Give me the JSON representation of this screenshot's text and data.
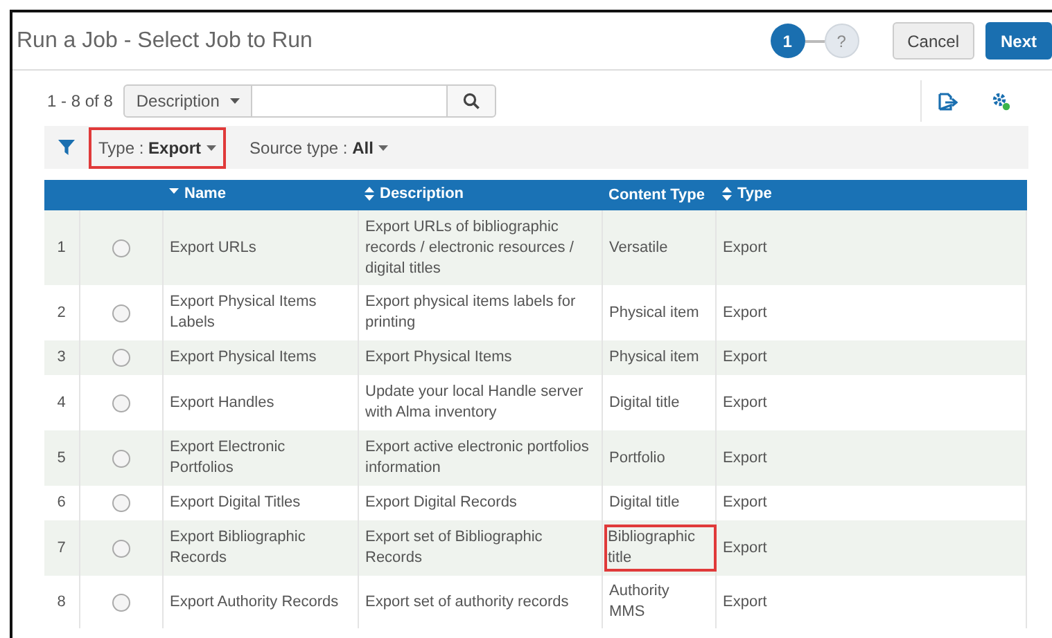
{
  "title": "Run a Job - Select Job to Run",
  "steps": [
    {
      "label": "1",
      "selected": true
    },
    {
      "label": "?",
      "selected": false
    }
  ],
  "buttons": [
    {
      "label": "Cancel",
      "kind": "secondary"
    },
    {
      "label": "Next",
      "kind": "primary"
    }
  ],
  "count": "1 - 8 of 8",
  "search": {
    "scope": "Description"
  },
  "filters": [
    {
      "label": "Type :",
      "value": "Export",
      "highlighted": true
    },
    {
      "label": "Source type :",
      "value": "All",
      "highlighted": false
    }
  ],
  "columns": [
    {
      "label": "Name",
      "sortable": true,
      "sorted": true
    },
    {
      "label": "Description",
      "sortable": true,
      "sorted": false
    },
    {
      "label": "Content Type",
      "sortable": false
    },
    {
      "label": "Type",
      "sortable": true,
      "sorted": false
    }
  ],
  "rows": [
    {
      "num": "1",
      "selected": false,
      "name": "Export URLs",
      "description": "Export URLs of bibliographic records / electronic resources / digital titles",
      "content_type": "Versatile",
      "content_highlighted": false,
      "type": "Export"
    },
    {
      "num": "2",
      "selected": false,
      "name": "Export Physical Items Labels",
      "description": "Export physical items labels for printing",
      "content_type": "Physical item",
      "content_highlighted": false,
      "type": "Export"
    },
    {
      "num": "3",
      "selected": false,
      "name": "Export Physical Items",
      "description": "Export Physical Items",
      "content_type": "Physical item",
      "content_highlighted": false,
      "type": "Export"
    },
    {
      "num": "4",
      "selected": false,
      "name": "Export Handles",
      "description": "Update your local Handle server with Alma inventory",
      "content_type": "Digital title",
      "content_highlighted": false,
      "type": "Export"
    },
    {
      "num": "5",
      "selected": false,
      "name": "Export Electronic Portfolios",
      "description": "Export active electronic portfolios information",
      "content_type": "Portfolio",
      "content_highlighted": false,
      "type": "Export"
    },
    {
      "num": "6",
      "selected": false,
      "name": "Export Digital Titles",
      "description": "Export Digital Records",
      "content_type": "Digital title",
      "content_highlighted": false,
      "type": "Export"
    },
    {
      "num": "7",
      "selected": false,
      "name": "Export Bibliographic Records",
      "description": "Export set of Bibliographic Records",
      "content_type": "Bibliographic title",
      "content_highlighted": true,
      "type": "Export"
    },
    {
      "num": "8",
      "selected": false,
      "name": "Export Authority Records",
      "description": "Export set of authority records",
      "content_type": "Authority MMS",
      "content_highlighted": false,
      "type": "Export"
    }
  ]
}
